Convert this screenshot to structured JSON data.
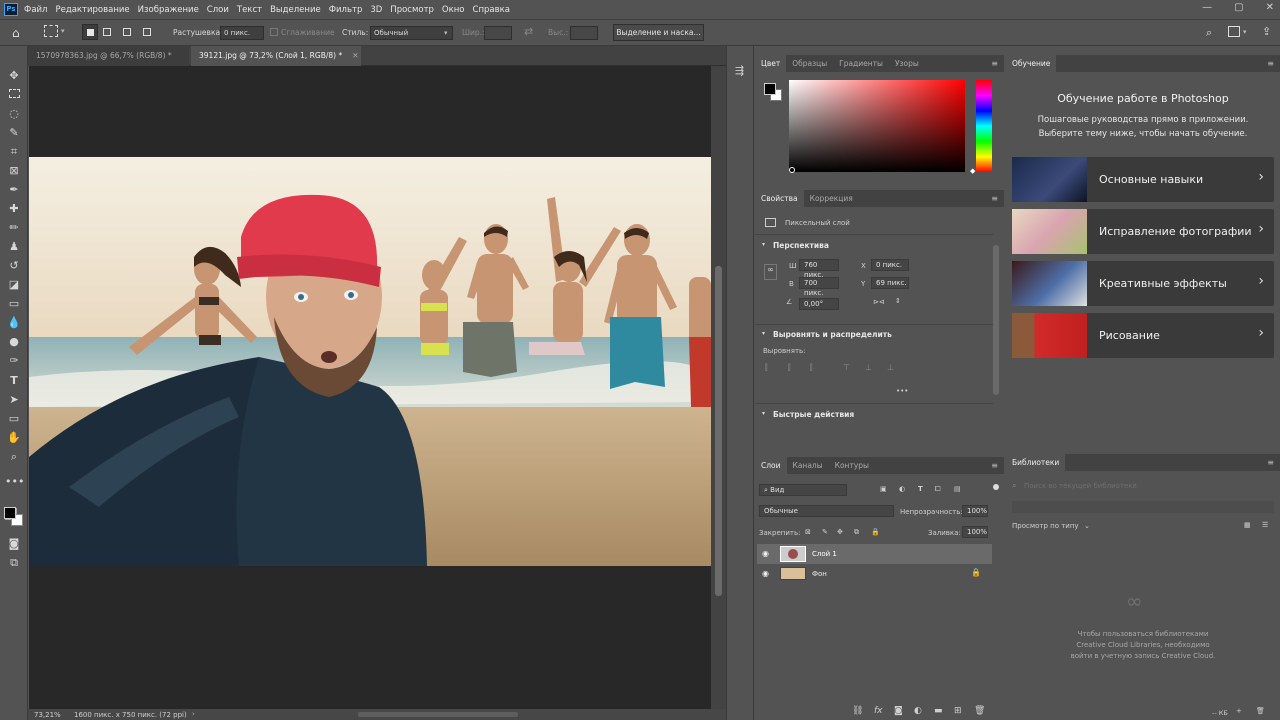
{
  "menu": {
    "logo": "Ps",
    "items": [
      "Файл",
      "Редактирование",
      "Изображение",
      "Слои",
      "Текст",
      "Выделение",
      "Фильтр",
      "3D",
      "Просмотр",
      "Окно",
      "Справка"
    ]
  },
  "options": {
    "feather_label": "Растушевка:",
    "feather_value": "0 пикс.",
    "antialias_label": "Сглаживание",
    "style_label": "Стиль:",
    "style_value": "Обычный",
    "width_label": "Шир.:",
    "height_label": "Выс.:",
    "select_mask_button": "Выделение и наска..."
  },
  "tabs": [
    {
      "label": "1570978363.jpg @ 66,7% (RGB/8) *"
    },
    {
      "label": "39121.jpg @ 73,2% (Слой 1, RGB/8) *"
    }
  ],
  "status": {
    "zoom": "73,21%",
    "doc_info": "1600 пикс. x 750 пикс. (72 ppi)"
  },
  "color_panel": {
    "tabs": [
      "Цвет",
      "Образцы",
      "Градиенты",
      "Узоры"
    ],
    "fg_color": "#000000",
    "bg_color": "#ffffff",
    "hue_color": "#ff0000"
  },
  "properties": {
    "tabs": [
      "Свойства",
      "Коррекция"
    ],
    "layer_kind": "Пиксельный слой",
    "section_transform": "Перспектива",
    "w_label": "Ш",
    "w_value": "760 пикс.",
    "h_label": "В",
    "h_value": "700 пикс.",
    "x_label": "X",
    "x_value": "0 пикс.",
    "y_label": "Y",
    "y_value": "69 пикс.",
    "angle_value": "0,00°",
    "section_align": "Выровнять и распределить",
    "align_label": "Выровнять:",
    "more": "•••",
    "section_quick": "Быстрые действия"
  },
  "layers": {
    "tabs": [
      "Слои",
      "Каналы",
      "Контуры"
    ],
    "filter_label": "Вид",
    "blend_mode": "Обычные",
    "opacity_label": "Непрозрачность:",
    "opacity_value": "100%",
    "lock_label": "Закрепить:",
    "fill_label": "Заливка:",
    "fill_value": "100%",
    "items": [
      {
        "name": "Слой 1",
        "selected": true
      },
      {
        "name": "Фон",
        "selected": false,
        "locked": true
      }
    ]
  },
  "learn": {
    "tab": "Обучение",
    "title": "Обучение работе в Photoshop",
    "subtitle1": "Пошаговые руководства прямо в приложении.",
    "subtitle2": "Выберите тему ниже, чтобы начать обучение.",
    "cards": [
      {
        "label": "Основные навыки"
      },
      {
        "label": "Исправление фотографии"
      },
      {
        "label": "Креативные эффекты"
      },
      {
        "label": "Рисование"
      }
    ]
  },
  "libraries": {
    "tab": "Библиотеки",
    "search_placeholder": "Поиск во текущей библиотеке",
    "view_by": "Просмотр по типу",
    "msg1": "Чтобы пользоваться библиотеками",
    "msg2": "Creative Cloud Libraries, необходимо",
    "msg3": "войти в учетную запись Creative Cloud.",
    "size": "-- КБ"
  }
}
